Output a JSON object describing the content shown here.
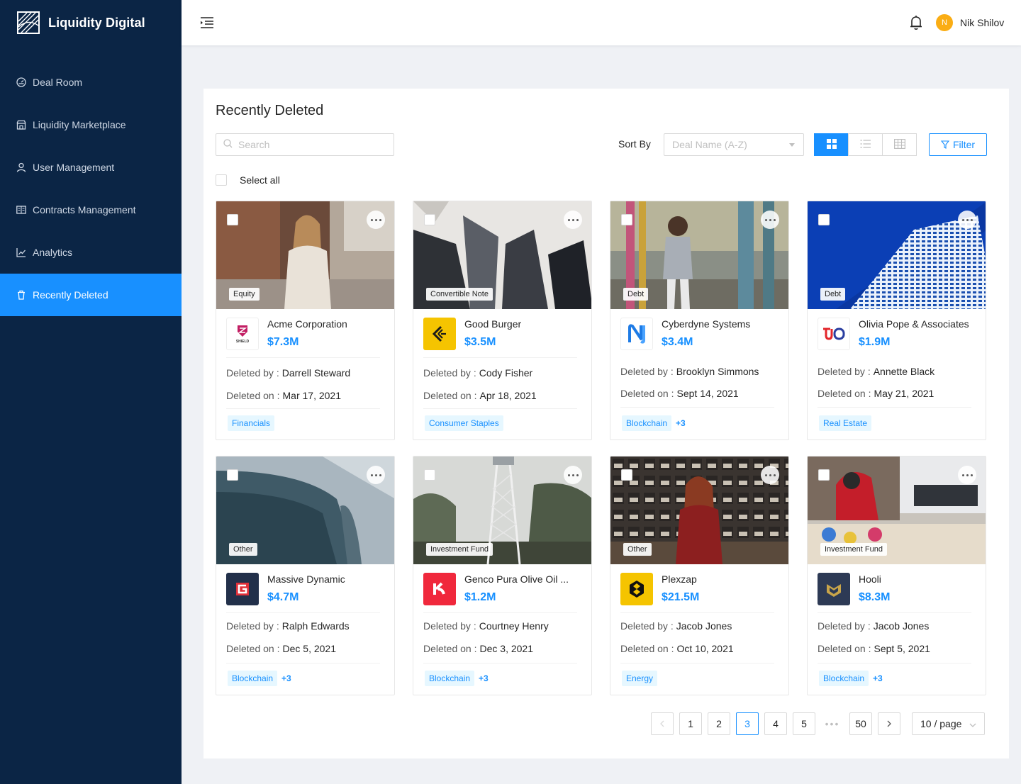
{
  "app": {
    "brand": "Liquidity Digital"
  },
  "sidebar": {
    "items": [
      {
        "label": "Deal Room",
        "icon": "dashboard-icon",
        "active": false
      },
      {
        "label": "Liquidity Marketplace",
        "icon": "shop-icon",
        "active": false
      },
      {
        "label": "User Management",
        "icon": "user-icon",
        "active": false
      },
      {
        "label": "Contracts Management",
        "icon": "contract-icon",
        "active": false
      },
      {
        "label": "Analytics",
        "icon": "line-chart-icon",
        "active": false
      },
      {
        "label": "Recently Deleted",
        "icon": "trash-icon",
        "active": true
      }
    ]
  },
  "header": {
    "user_initial": "N",
    "user_name": "Nik Shilov"
  },
  "main": {
    "title": "Recently Deleted",
    "search_placeholder": "Search",
    "sort_label": "Sort By",
    "sort_placeholder": "Deal Name (A-Z)",
    "filter_label": "Filter",
    "select_all_label": "Select all",
    "deleted_by_label": "Deleted by :",
    "deleted_on_label": "Deleted on :"
  },
  "colors": {
    "accent": "#1890ff",
    "sidebar_bg": "#0b2545",
    "page_bg": "#eff1f5"
  },
  "deals": [
    {
      "type": "Equity",
      "name": "Acme Corporation",
      "amount": "$7.3M",
      "deleted_by": "Darrell Steward",
      "deleted_on": "Mar 17, 2021",
      "tag": "Financials",
      "more": ""
    },
    {
      "type": "Convertible Note",
      "name": "Good Burger",
      "amount": "$3.5M",
      "deleted_by": "Cody Fisher",
      "deleted_on": "Apr 18, 2021",
      "tag": "Consumer Staples",
      "more": ""
    },
    {
      "type": "Debt",
      "name": "Cyberdyne Systems",
      "amount": "$3.4M",
      "deleted_by": "Brooklyn Simmons",
      "deleted_on": "Sept 14, 2021",
      "tag": "Blockchain",
      "more": "+3"
    },
    {
      "type": "Debt",
      "name": "Olivia Pope & Associates",
      "amount": "$1.9M",
      "deleted_by": "Annette Black",
      "deleted_on": "May 21, 2021",
      "tag": "Real Estate",
      "more": ""
    },
    {
      "type": "Other",
      "name": "Massive Dynamic",
      "amount": "$4.7M",
      "deleted_by": "Ralph Edwards",
      "deleted_on": "Dec 5, 2021",
      "tag": "Blockchain",
      "more": "+3"
    },
    {
      "type": "Investment Fund",
      "name": "Genco Pura Olive Oil ...",
      "amount": "$1.2M",
      "deleted_by": "Courtney Henry",
      "deleted_on": "Dec 3, 2021",
      "tag": "Blockchain",
      "more": "+3"
    },
    {
      "type": "Other",
      "name": "Plexzap",
      "amount": "$21.5M",
      "deleted_by": "Jacob Jones",
      "deleted_on": "Oct 10, 2021",
      "tag": "Energy",
      "more": ""
    },
    {
      "type": "Investment Fund",
      "name": "Hooli",
      "amount": "$8.3M",
      "deleted_by": "Jacob Jones",
      "deleted_on": "Sept 5, 2021",
      "tag": "Blockchain",
      "more": "+3"
    }
  ],
  "pagination": {
    "pages": [
      "1",
      "2",
      "3",
      "4",
      "5"
    ],
    "current": "3",
    "last": "50",
    "ellipsis": "•••",
    "page_size": "10 / page"
  }
}
